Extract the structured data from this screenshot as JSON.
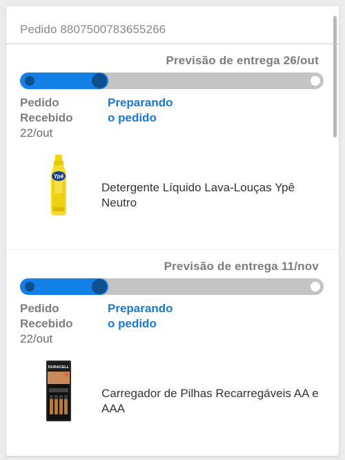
{
  "order": {
    "label": "Pedido 8807500783655266"
  },
  "shipments": [
    {
      "eta": "Previsão de entrega 26/out",
      "progress_fraction": 0.29,
      "steps": [
        {
          "line1": "Pedido",
          "line2": "Recebido",
          "date": "22/out"
        },
        {
          "line1": "Preparando",
          "line2": "o pedido"
        }
      ],
      "product": {
        "name": "Detergente Líquido Lava-Louças Ypê Neutro",
        "image_icon": "detergent-bottle-icon",
        "brand_label": "Ypê"
      }
    },
    {
      "eta": "Previsão de entrega 11/nov",
      "progress_fraction": 0.29,
      "steps": [
        {
          "line1": "Pedido",
          "line2": "Recebido",
          "date": "22/out"
        },
        {
          "line1": "Preparando",
          "line2": "o pedido"
        }
      ],
      "product": {
        "name": "Carregador de Pilhas Recarregáveis AA e AAA",
        "image_icon": "battery-charger-icon",
        "brand_label": "DURACELL"
      }
    }
  ],
  "colors": {
    "progress_fill": "#1380e6",
    "progress_track": "#c4c4c4",
    "progress_dot": "#0d4f8f",
    "active_step": "#1978d2",
    "inactive_step": "#7c7c7c"
  }
}
